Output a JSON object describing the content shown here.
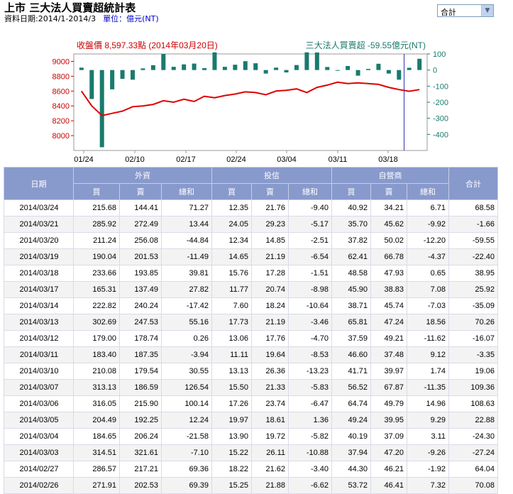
{
  "header": {
    "title": "上市 三大法人買賣超統計表",
    "date_label": "資料日期:2014/1-2014/3",
    "unit_label": "單位：億元(NT)"
  },
  "select": {
    "value": "合計"
  },
  "chart_data": {
    "type": "bar+line",
    "left_title": "收盤價 8,597.33點 (2014年03月20日)",
    "right_title": "三大法人買賣超 -59.55億元(NT)",
    "x_tick_labels": [
      "01/24",
      "02/10",
      "02/17",
      "02/24",
      "03/04",
      "03/11",
      "03/18"
    ],
    "left_ticks": [
      "9000",
      "8800",
      "8600",
      "8400",
      "8200",
      "8000"
    ],
    "right_ticks": [
      "100",
      "0",
      "-100",
      "-200",
      "-300",
      "-400"
    ],
    "left_ylim": [
      7800,
      9100
    ],
    "right_ylim": [
      -500,
      100
    ],
    "bar_values": [
      15,
      -180,
      -480,
      -120,
      -55,
      -60,
      10,
      30,
      100,
      20,
      35,
      40,
      12,
      110,
      20,
      33,
      55,
      42,
      -22,
      15,
      -15,
      31,
      110,
      109,
      19,
      -3,
      25,
      -35,
      7,
      39,
      -22,
      -60,
      14,
      70
    ],
    "close_values": [
      8600,
      8400,
      8270,
      8300,
      8330,
      8390,
      8400,
      8420,
      8470,
      8450,
      8490,
      8460,
      8530,
      8510,
      8540,
      8560,
      8590,
      8580,
      8550,
      8600,
      8610,
      8630,
      8580,
      8650,
      8680,
      8720,
      8700,
      8710,
      8700,
      8690,
      8650,
      8620,
      8597,
      8620
    ],
    "colors": {
      "bar": "#1a7a6e",
      "line": "#e00000",
      "marker": "#3333aa",
      "left_title": "#cc0000",
      "right_title": "#1a7a6e"
    }
  },
  "table": {
    "group_headers": {
      "date": "日期",
      "foreign": "外資",
      "trust": "投信",
      "dealer": "自營商",
      "total": "合計"
    },
    "sub_headers": [
      "買",
      "賣",
      "總和",
      "買",
      "賣",
      "總和",
      "買",
      "賣",
      "總和"
    ],
    "rows": [
      [
        "2014/03/24",
        "215.68",
        "144.41",
        "71.27",
        "12.35",
        "21.76",
        "-9.40",
        "40.92",
        "34.21",
        "6.71",
        "68.58"
      ],
      [
        "2014/03/21",
        "285.92",
        "272.49",
        "13.44",
        "24.05",
        "29.23",
        "-5.17",
        "35.70",
        "45.62",
        "-9.92",
        "-1.66"
      ],
      [
        "2014/03/20",
        "211.24",
        "256.08",
        "-44.84",
        "12.34",
        "14.85",
        "-2.51",
        "37.82",
        "50.02",
        "-12.20",
        "-59.55"
      ],
      [
        "2014/03/19",
        "190.04",
        "201.53",
        "-11.49",
        "14.65",
        "21.19",
        "-6.54",
        "62.41",
        "66.78",
        "-4.37",
        "-22.40"
      ],
      [
        "2014/03/18",
        "233.66",
        "193.85",
        "39.81",
        "15.76",
        "17.28",
        "-1.51",
        "48.58",
        "47.93",
        "0.65",
        "38.95"
      ],
      [
        "2014/03/17",
        "165.31",
        "137.49",
        "27.82",
        "11.77",
        "20.74",
        "-8.98",
        "45.90",
        "38.83",
        "7.08",
        "25.92"
      ],
      [
        "2014/03/14",
        "222.82",
        "240.24",
        "-17.42",
        "7.60",
        "18.24",
        "-10.64",
        "38.71",
        "45.74",
        "-7.03",
        "-35.09"
      ],
      [
        "2014/03/13",
        "302.69",
        "247.53",
        "55.16",
        "17.73",
        "21.19",
        "-3.46",
        "65.81",
        "47.24",
        "18.56",
        "70.26"
      ],
      [
        "2014/03/12",
        "179.00",
        "178.74",
        "0.26",
        "13.06",
        "17.76",
        "-4.70",
        "37.59",
        "49.21",
        "-11.62",
        "-16.07"
      ],
      [
        "2014/03/11",
        "183.40",
        "187.35",
        "-3.94",
        "11.11",
        "19.64",
        "-8.53",
        "46.60",
        "37.48",
        "9.12",
        "-3.35"
      ],
      [
        "2014/03/10",
        "210.08",
        "179.54",
        "30.55",
        "13.13",
        "26.36",
        "-13.23",
        "41.71",
        "39.97",
        "1.74",
        "19.06"
      ],
      [
        "2014/03/07",
        "313.13",
        "186.59",
        "126.54",
        "15.50",
        "21.33",
        "-5.83",
        "56.52",
        "67.87",
        "-11.35",
        "109.36"
      ],
      [
        "2014/03/06",
        "316.05",
        "215.90",
        "100.14",
        "17.26",
        "23.74",
        "-6.47",
        "64.74",
        "49.79",
        "14.96",
        "108.63"
      ],
      [
        "2014/03/05",
        "204.49",
        "192.25",
        "12.24",
        "19.97",
        "18.61",
        "1.36",
        "49.24",
        "39.95",
        "9.29",
        "22.88"
      ],
      [
        "2014/03/04",
        "184.65",
        "206.24",
        "-21.58",
        "13.90",
        "19.72",
        "-5.82",
        "40.19",
        "37.09",
        "3.11",
        "-24.30"
      ],
      [
        "2014/03/03",
        "314.51",
        "321.61",
        "-7.10",
        "15.22",
        "26.11",
        "-10.88",
        "37.94",
        "47.20",
        "-9.26",
        "-27.24"
      ],
      [
        "2014/02/27",
        "286.57",
        "217.21",
        "69.36",
        "18.22",
        "21.62",
        "-3.40",
        "44.30",
        "46.21",
        "-1.92",
        "64.04"
      ],
      [
        "2014/02/26",
        "271.91",
        "202.53",
        "69.39",
        "15.25",
        "21.88",
        "-6.62",
        "53.72",
        "46.41",
        "7.32",
        "70.08"
      ]
    ]
  }
}
